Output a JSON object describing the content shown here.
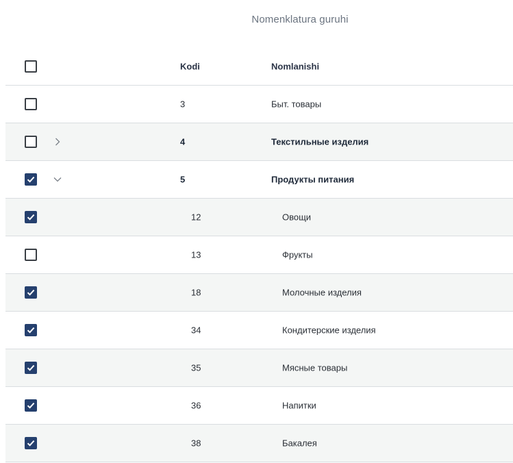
{
  "title": "Nomenklatura guruhi",
  "columns": {
    "code": "Kodi",
    "name": "Nomlanishi"
  },
  "header_checked": false,
  "rows": [
    {
      "code": "3",
      "name": "Быт. товары",
      "checked": false,
      "level": 0,
      "group": false,
      "expanded": null
    },
    {
      "code": "4",
      "name": "Текстильные изделия",
      "checked": false,
      "level": 0,
      "group": true,
      "expanded": false
    },
    {
      "code": "5",
      "name": "Продукты питания",
      "checked": true,
      "level": 0,
      "group": true,
      "expanded": true
    },
    {
      "code": "12",
      "name": "Овощи",
      "checked": true,
      "level": 1,
      "group": false,
      "expanded": null
    },
    {
      "code": "13",
      "name": "Фрукты",
      "checked": false,
      "level": 1,
      "group": false,
      "expanded": null
    },
    {
      "code": "18",
      "name": "Молочные изделия",
      "checked": true,
      "level": 1,
      "group": false,
      "expanded": null
    },
    {
      "code": "34",
      "name": "Кондитерские изделия",
      "checked": true,
      "level": 1,
      "group": false,
      "expanded": null
    },
    {
      "code": "35",
      "name": "Мясные товары",
      "checked": true,
      "level": 1,
      "group": false,
      "expanded": null
    },
    {
      "code": "36",
      "name": "Напитки",
      "checked": true,
      "level": 1,
      "group": false,
      "expanded": null
    },
    {
      "code": "38",
      "name": "Бакалея",
      "checked": true,
      "level": 1,
      "group": false,
      "expanded": null
    }
  ],
  "icons": {
    "expand": "chevron-right-icon",
    "collapse": "chevron-down-icon",
    "check": "check-icon"
  },
  "colors": {
    "accent": "#25406e",
    "row_alt": "#f4f6f5",
    "border": "#d9dde0"
  }
}
